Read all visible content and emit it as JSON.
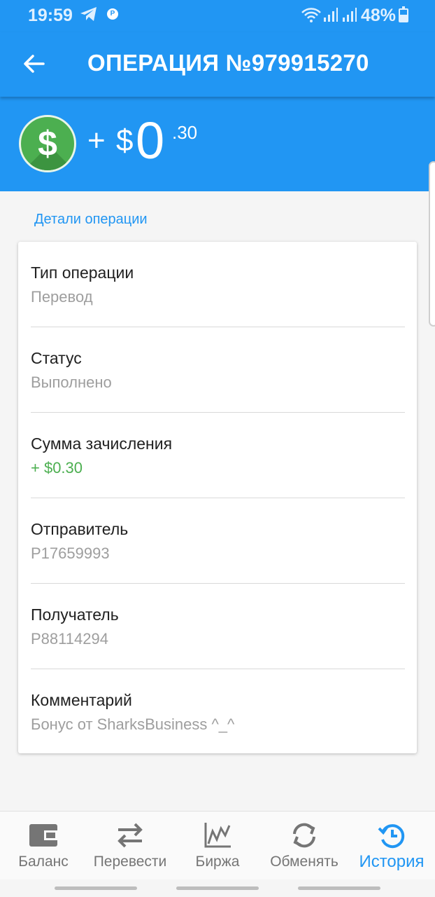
{
  "status_bar": {
    "time": "19:59",
    "battery": "48%"
  },
  "app_bar": {
    "title": "ОПЕРАЦИЯ №979915270"
  },
  "hero": {
    "sign": "+",
    "currency": "$",
    "integer": "0",
    "cents": ".30",
    "icon": "dollar-coin-icon",
    "icon_text": "$"
  },
  "details": {
    "section_title": "Детали операции",
    "rows": [
      {
        "label": "Тип операции",
        "value": "Перевод"
      },
      {
        "label": "Статус",
        "value": "Выполнено"
      },
      {
        "label": "Сумма зачисления",
        "value": "+ $0.30"
      },
      {
        "label": "Отправитель",
        "value": "P17659993"
      },
      {
        "label": "Получатель",
        "value": "P88114294"
      },
      {
        "label": "Комментарий",
        "value": "Бонус от SharksBusiness ^_^"
      }
    ]
  },
  "bottom_nav": {
    "items": [
      {
        "label": "Баланс",
        "icon": "wallet-icon"
      },
      {
        "label": "Перевести",
        "icon": "transfer-arrows-icon"
      },
      {
        "label": "Биржа",
        "icon": "chart-icon"
      },
      {
        "label": "Обменять",
        "icon": "exchange-icon"
      },
      {
        "label": "История",
        "icon": "history-icon"
      }
    ],
    "active_index": 4
  },
  "colors": {
    "primary": "#2196f3",
    "success": "#4caf50",
    "muted": "#9e9e9e"
  }
}
